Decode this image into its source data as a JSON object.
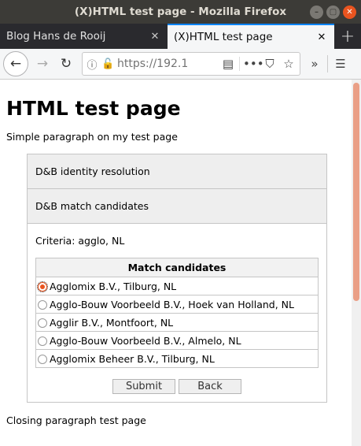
{
  "window": {
    "title": "(X)HTML test page - Mozilla Firefox"
  },
  "tabs": [
    {
      "label": "Blog Hans de Rooij",
      "active": false
    },
    {
      "label": "(X)HTML test page",
      "active": true
    }
  ],
  "toolbar": {
    "url": "https://192.1",
    "icons": [
      "back-icon",
      "forward-icon",
      "reload-icon",
      "info-icon",
      "insecure-lock-icon",
      "reader-view-icon",
      "page-actions-icon",
      "pocket-icon",
      "bookmark-star-icon",
      "overflow-icon",
      "menu-icon"
    ]
  },
  "page": {
    "heading": "HTML test page",
    "intro": "Simple paragraph on my test page",
    "accordion": {
      "sections": [
        {
          "label": "D&B identity resolution"
        },
        {
          "label": "D&B match candidates"
        }
      ],
      "criteria": "Criteria: agglo, NL",
      "table_header": "Match candidates",
      "candidates": [
        {
          "label": "Agglomix B.V., Tilburg, NL",
          "checked": true
        },
        {
          "label": "Agglo-Bouw Voorbeeld B.V., Hoek van Holland, NL",
          "checked": false
        },
        {
          "label": "Agglir B.V., Montfoort, NL",
          "checked": false
        },
        {
          "label": "Agglo-Bouw Voorbeeld B.V., Almelo, NL",
          "checked": false
        },
        {
          "label": "Agglomix Beheer B.V., Tilburg, NL",
          "checked": false
        }
      ],
      "submit_label": "Submit",
      "back_label": "Back"
    },
    "closing": "Closing paragraph test page"
  },
  "colors": {
    "accent": "#e9541f",
    "titlebar": "#3c3b37",
    "tabbar": "#2a2a2e",
    "active_tab_line": "#0a84ff"
  }
}
